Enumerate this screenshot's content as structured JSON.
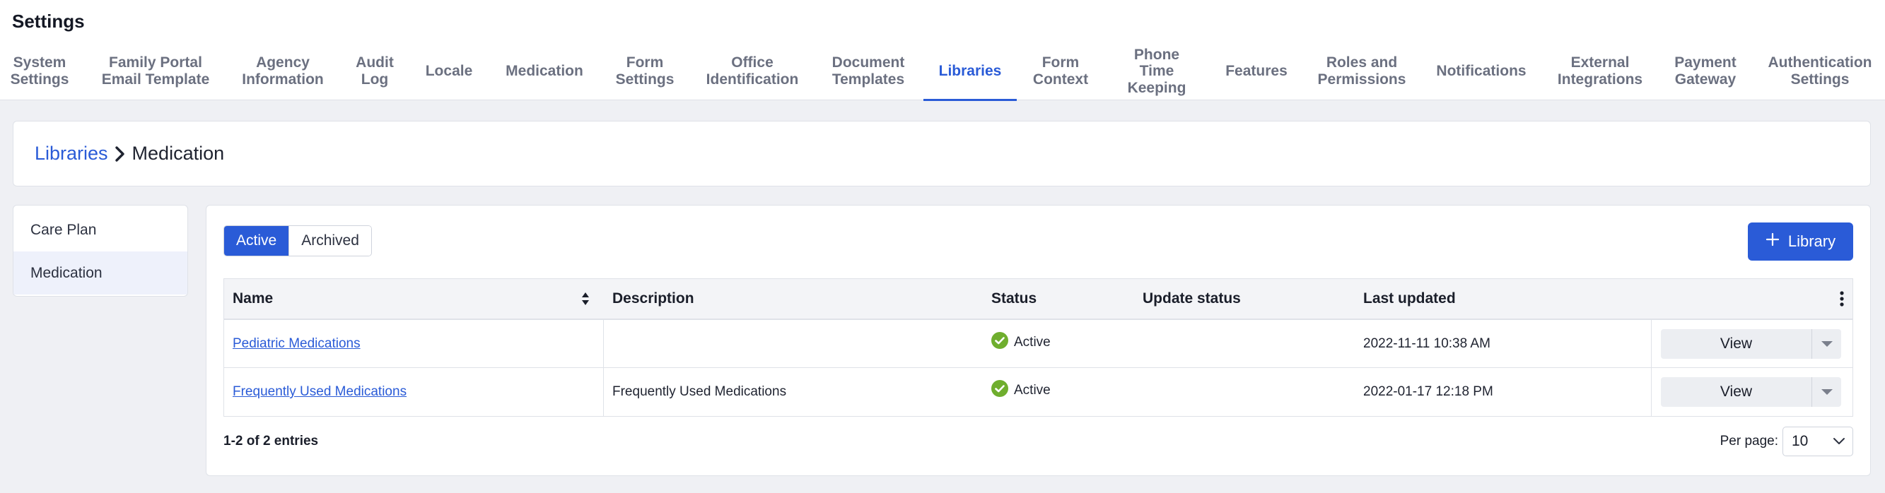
{
  "page_title": "Settings",
  "tabs": [
    {
      "label": "System\nSettings"
    },
    {
      "label": "Family Portal\nEmail Template"
    },
    {
      "label": "Agency\nInformation"
    },
    {
      "label": "Audit\nLog"
    },
    {
      "label": "Locale"
    },
    {
      "label": "Medication"
    },
    {
      "label": "Form\nSettings"
    },
    {
      "label": "Office\nIdentification"
    },
    {
      "label": "Document\nTemplates"
    },
    {
      "label": "Libraries"
    },
    {
      "label": "Form\nContext"
    },
    {
      "label": "Phone\nTime\nKeeping"
    },
    {
      "label": "Features"
    },
    {
      "label": "Roles and\nPermissions"
    },
    {
      "label": "Notifications"
    },
    {
      "label": "External\nIntegrations"
    },
    {
      "label": "Payment\nGateway"
    },
    {
      "label": "Authentication\nSettings"
    }
  ],
  "active_tab": "Libraries",
  "breadcrumb": {
    "parent": "Libraries",
    "current": "Medication"
  },
  "sidebar": {
    "items": [
      {
        "label": "Care Plan"
      },
      {
        "label": "Medication"
      }
    ],
    "active": "Medication"
  },
  "filter": {
    "active_label": "Active",
    "archived_label": "Archived",
    "selected": "Active"
  },
  "add_button": {
    "label": "Library",
    "icon": "plus-icon"
  },
  "table": {
    "columns": [
      "Name",
      "Description",
      "Status",
      "Update status",
      "Last updated"
    ],
    "rows": [
      {
        "name": "Pediatric Medications",
        "description": "",
        "status": "Active",
        "update_status": "",
        "last_updated": "2022-11-11 10:38 AM",
        "action": "View"
      },
      {
        "name": "Frequently Used Medications",
        "description": "Frequently Used Medications",
        "status": "Active",
        "update_status": "",
        "last_updated": "2022-01-17 12:18 PM",
        "action": "View"
      }
    ]
  },
  "footer": {
    "entries": "1-2 of 2 entries",
    "per_page_label": "Per page:",
    "per_page_value": "10"
  },
  "colors": {
    "accent": "#2a5bd7",
    "success": "#6fae2e",
    "background": "#eff0f4"
  }
}
